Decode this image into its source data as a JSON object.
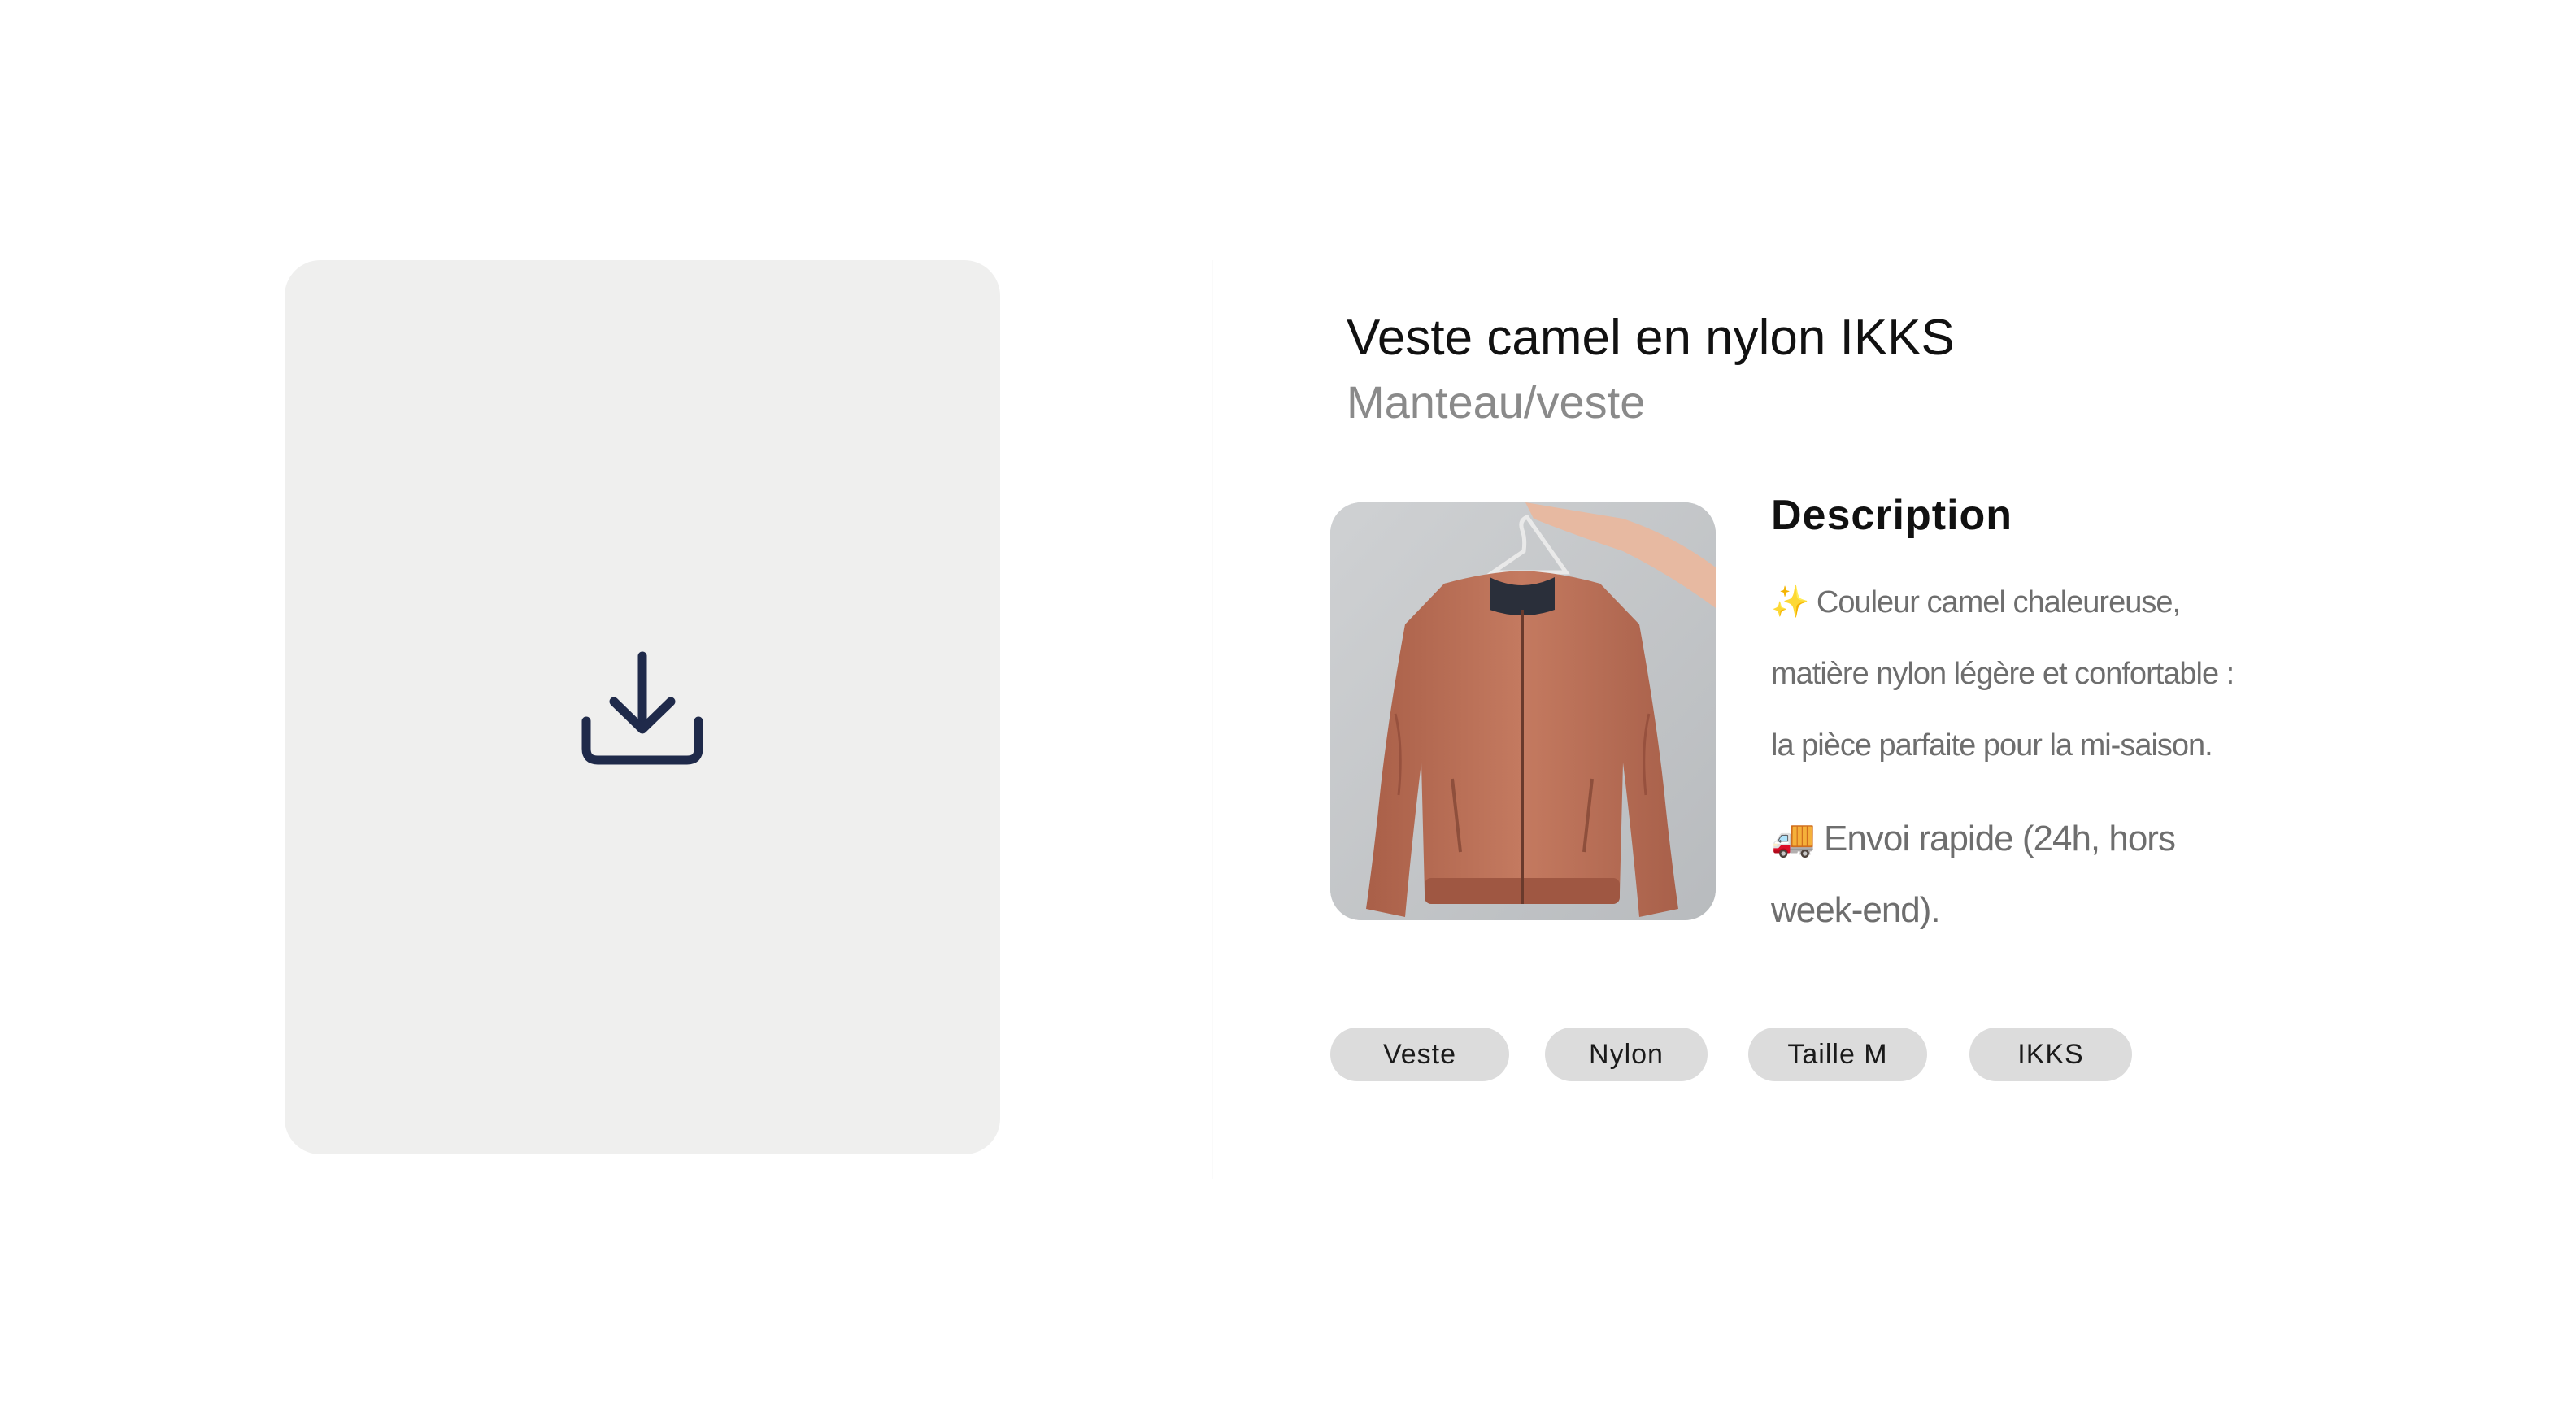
{
  "upload": {
    "icon": "download-icon",
    "icon_color": "#1f2a4a",
    "panel_color": "#efefee"
  },
  "product": {
    "title": "Veste camel en nylon IKKS",
    "category": "Manteau/veste",
    "photo_description_icon": "jacket-photo"
  },
  "description": {
    "heading": "Description",
    "sparkle_icon": "✨",
    "line1": "Couleur camel chaleureuse,",
    "line2": "matière nylon légère et confortable :",
    "line3": "la pièce parfaite pour la mi-saison.",
    "truck_icon": "🚚",
    "shipping_line1": "Envoi rapide (24h, hors",
    "shipping_line2": "week-end)."
  },
  "tags": [
    "Veste",
    "Nylon",
    "Taille M",
    "IKKS"
  ],
  "colors": {
    "tag_background": "#dcdcdc",
    "muted_text": "#6e6e6e",
    "jacket": "#c0725a"
  }
}
